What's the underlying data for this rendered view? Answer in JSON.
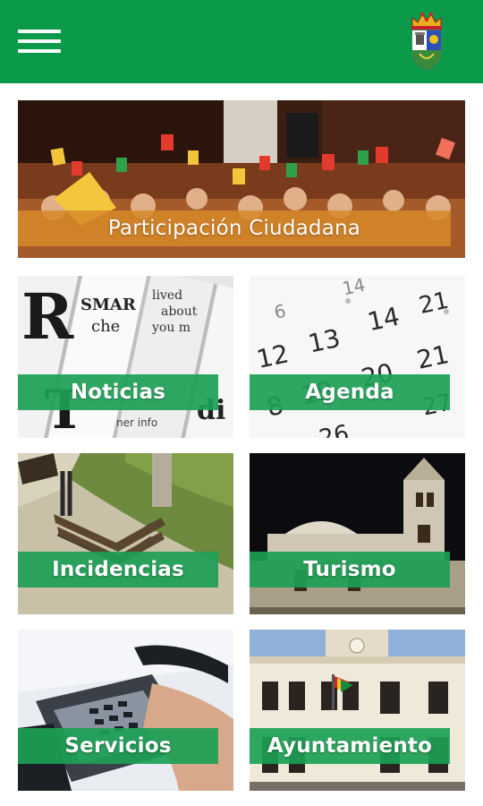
{
  "header": {
    "menu_icon": "hamburger-menu-icon",
    "logo_icon": "town-crest-icon",
    "bar_color": "#0a9a4a"
  },
  "tiles": [
    {
      "label": "Participación Ciudadana",
      "image": "raised-voting-cards-crowd"
    },
    {
      "label": "Noticias",
      "image": "newspapers"
    },
    {
      "label": "Agenda",
      "image": "calendar-numbers"
    },
    {
      "label": "Incidencias",
      "image": "broken-park-bench"
    },
    {
      "label": "Turismo",
      "image": "church-at-night"
    },
    {
      "label": "Servicios",
      "image": "telephone-keypad"
    },
    {
      "label": "Ayuntamiento",
      "image": "town-hall-facade"
    }
  ]
}
